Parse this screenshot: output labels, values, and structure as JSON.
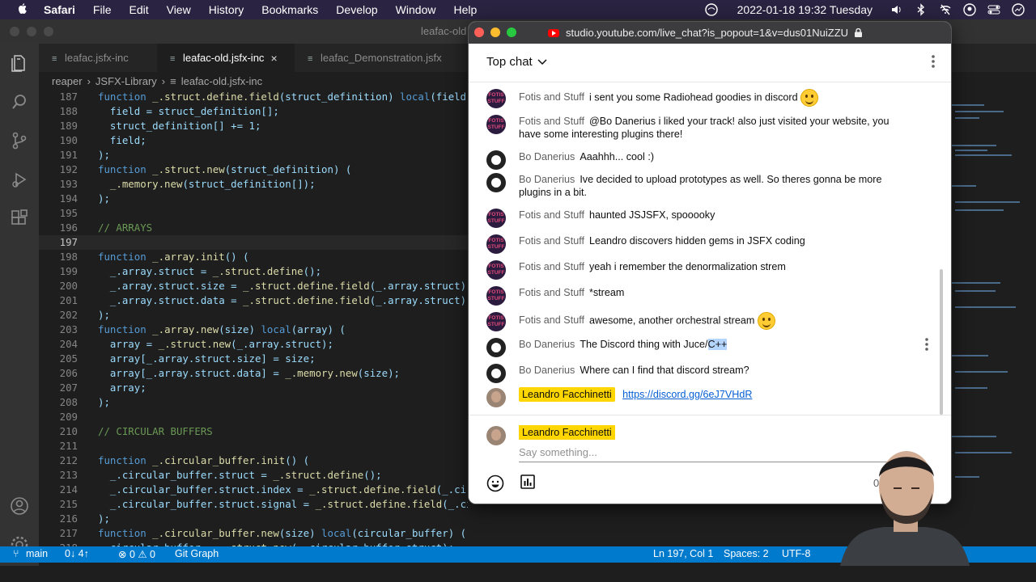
{
  "menubar": {
    "items": [
      "Safari",
      "File",
      "Edit",
      "View",
      "History",
      "Bookmarks",
      "Develop",
      "Window",
      "Help"
    ],
    "clock": "2022-01-18  19:32  Tuesday"
  },
  "vscode": {
    "title": "leafac-old",
    "tabs": [
      {
        "label": "leafac.jsfx-inc"
      },
      {
        "label": "leafac-old.jsfx-inc",
        "close": "×"
      },
      {
        "label": "leafac_Demonstration.jsfx"
      }
    ],
    "breadcrumb": [
      "reaper",
      "JSFX-Library",
      "leafac-old.jsfx-inc"
    ],
    "lines": [
      {
        "n": "187",
        "code": "function _.struct.define.field(struct_definition) local(field) ("
      },
      {
        "n": "188",
        "code": "  field = struct_definition[];"
      },
      {
        "n": "189",
        "code": "  struct_definition[] += 1;"
      },
      {
        "n": "190",
        "code": "  field;"
      },
      {
        "n": "191",
        "code": ");"
      },
      {
        "n": "192",
        "code": "function _.struct.new(struct_definition) ("
      },
      {
        "n": "193",
        "code": "  _.memory.new(struct_definition[]);"
      },
      {
        "n": "194",
        "code": ");"
      },
      {
        "n": "195",
        "code": ""
      },
      {
        "n": "196",
        "code": "// ARRAYS"
      },
      {
        "n": "197",
        "code": ""
      },
      {
        "n": "198",
        "code": "function _.array.init() ("
      },
      {
        "n": "199",
        "code": "  _.array.struct = _.struct.define();"
      },
      {
        "n": "200",
        "code": "  _.array.struct.size = _.struct.define.field(_.array.struct);"
      },
      {
        "n": "201",
        "code": "  _.array.struct.data = _.struct.define.field(_.array.struct);"
      },
      {
        "n": "202",
        "code": ");"
      },
      {
        "n": "203",
        "code": "function _.array.new(size) local(array) ("
      },
      {
        "n": "204",
        "code": "  array = _.struct.new(_.array.struct);"
      },
      {
        "n": "205",
        "code": "  array[_.array.struct.size] = size;"
      },
      {
        "n": "206",
        "code": "  array[_.array.struct.data] = _.memory.new(size);"
      },
      {
        "n": "207",
        "code": "  array;"
      },
      {
        "n": "208",
        "code": ");"
      },
      {
        "n": "209",
        "code": ""
      },
      {
        "n": "210",
        "code": "// CIRCULAR BUFFERS"
      },
      {
        "n": "211",
        "code": ""
      },
      {
        "n": "212",
        "code": "function _.circular_buffer.init() ("
      },
      {
        "n": "213",
        "code": "  _.circular_buffer.struct = _.struct.define();"
      },
      {
        "n": "214",
        "code": "  _.circular_buffer.struct.index = _.struct.define.field(_.circular_buffer.struct);"
      },
      {
        "n": "215",
        "code": "  _.circular_buffer.struct.signal = _.struct.define.field(_.circular_buffer.struct);"
      },
      {
        "n": "216",
        "code": ");"
      },
      {
        "n": "217",
        "code": "function _.circular_buffer.new(size) local(circular_buffer) ("
      },
      {
        "n": "218",
        "code": "  circular_buffer = _.struct.new(_.circular_buffer.struct);"
      }
    ],
    "status": {
      "branch": "main",
      "sync": "0↓ 4↑",
      "problems": "⊗ 0 ⚠ 0",
      "git_graph": "Git Graph",
      "position": "Ln 197, Col 1",
      "spaces": "Spaces: 2",
      "encoding": "UTF-8"
    }
  },
  "safari": {
    "url": "studio.youtube.com/live_chat?is_popout=1&v=dus01NuiZZU",
    "chat_mode": "Top chat",
    "messages": [
      {
        "author": "Fotis and Stuff",
        "text": "i sent you some Radiohead goodies in discord",
        "emoji": true
      },
      {
        "author": "Fotis and Stuff",
        "text": "@Bo Danerius i liked your track! also just visited your website, you have some interesting plugins there!"
      },
      {
        "author": "Bo Danerius",
        "text": "Aaahhh... cool :)"
      },
      {
        "author": "Bo Danerius",
        "text": "Ive decided to upload prototypes as well. So theres gonna be more plugins in a bit."
      },
      {
        "author": "Fotis and Stuff",
        "text": "haunted JSJSFX, spooooky"
      },
      {
        "author": "Fotis and Stuff",
        "text": "Leandro discovers hidden gems in JSFX coding"
      },
      {
        "author": "Fotis and Stuff",
        "text": "yeah i remember the denormalization strem"
      },
      {
        "author": "Fotis and Stuff",
        "text": "*stream"
      },
      {
        "author": "Fotis and Stuff",
        "text": "awesome, another orchestral stream",
        "emoji": true
      },
      {
        "author": "Bo Danerius",
        "text": "The Discord thing with Juce/",
        "selected": "C++"
      },
      {
        "author": "Bo Danerius",
        "text": "Where can I find that discord stream?"
      },
      {
        "author": "Leandro Facchinetti",
        "link": "https://discord.gg/6eJ7VHdR"
      }
    ],
    "avatar_text": "FOTIS\nSTUFF",
    "composer": {
      "name": "Leandro Facchinetti",
      "placeholder": "Say something...",
      "count": "0/"
    }
  }
}
